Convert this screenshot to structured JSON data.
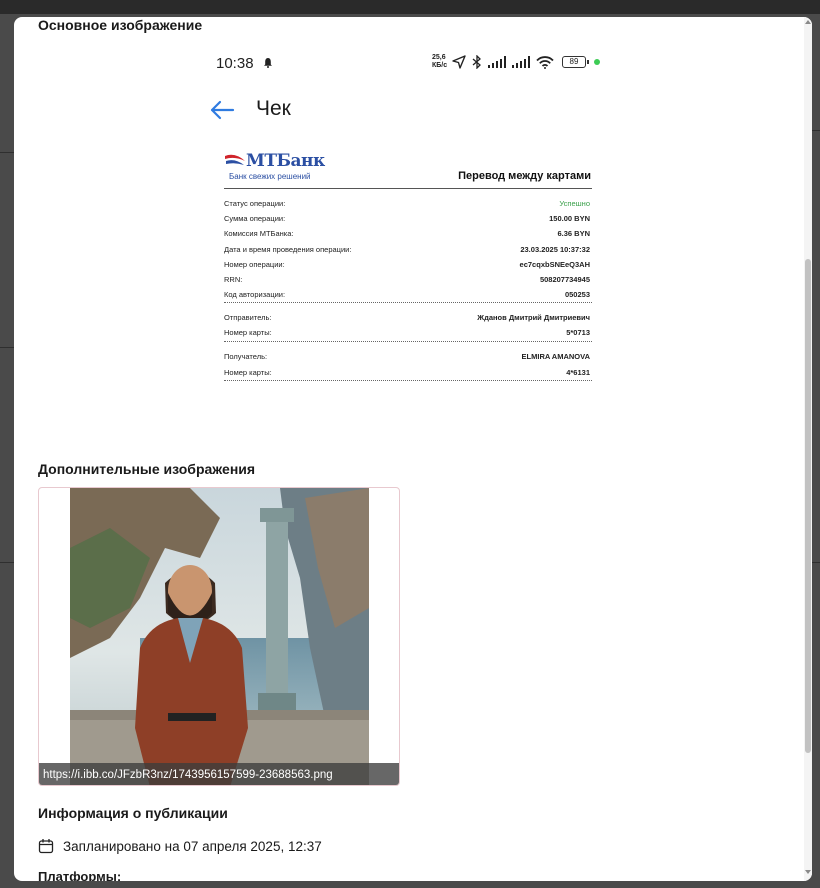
{
  "modal": {
    "main_image_title": "Основное изображение",
    "additional_images_title": "Дополнительные изображения",
    "publication_info_title": "Информация о публикации",
    "scheduled_text": "Запланировано на 07 апреля 2025, 12:37",
    "platforms_label": "Платформы:"
  },
  "phone": {
    "time": "10:38",
    "net_speed_top": "25,6",
    "net_speed_bottom": "КБ/с",
    "battery": "89",
    "screen_title": "Чек"
  },
  "receipt": {
    "bank_name": "МТБанк",
    "bank_slogan": "Банк свежих решений",
    "heading": "Перевод между картами",
    "rows": [
      {
        "label": "Статус операции:",
        "value": "Успешно"
      },
      {
        "label": "Сумма операции:",
        "value": "150.00 BYN"
      },
      {
        "label": "Комиссия МТБанка:",
        "value": "6.36 BYN"
      },
      {
        "label": "Дата и время проведения операции:",
        "value": "23.03.2025 10:37:32"
      },
      {
        "label": "Номер операции:",
        "value": "ec7cqxbSNEeQ3AH"
      },
      {
        "label": "RRN:",
        "value": "508207734945"
      },
      {
        "label": "Код авторизации:",
        "value": "050253"
      }
    ],
    "sender": [
      {
        "label": "Отправитель:",
        "value": "Жданов Дмитрий Дмитриевич"
      },
      {
        "label": "Номер карты:",
        "value": "5*0713"
      }
    ],
    "recipient": [
      {
        "label": "Получатель:",
        "value": "ELMIRA AMANOVA"
      },
      {
        "label": "Номер карты:",
        "value": "4*6131"
      }
    ]
  },
  "additional_image": {
    "url": "https://i.ibb.co/JFzbR3nz/1743956157599-23688563.png"
  },
  "colors": {
    "success": "#3aa04a",
    "bank_blue": "#2b4fa3",
    "back_arrow": "#2f7be0"
  },
  "icons": [
    "bell-icon",
    "location-arrow-icon",
    "bluetooth-icon",
    "signal-icon",
    "wifi-icon",
    "battery-icon",
    "back-arrow-icon",
    "calendar-icon"
  ]
}
